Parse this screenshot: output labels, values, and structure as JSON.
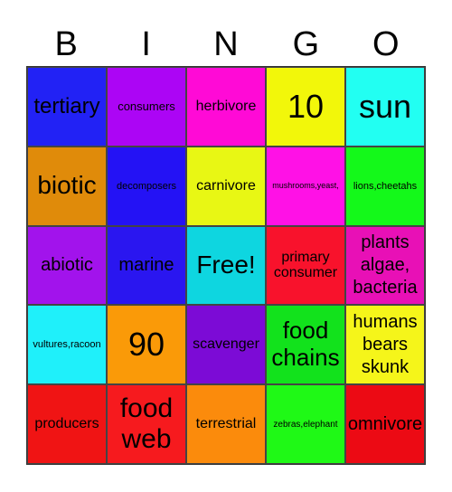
{
  "header": {
    "letters": [
      "B",
      "I",
      "N",
      "G",
      "O"
    ]
  },
  "cells": [
    {
      "text": "tertiary",
      "color": "#2222f5"
    },
    {
      "text": "consumers",
      "color": "#ac05f5"
    },
    {
      "text": "herbivore",
      "color": "#ff0ad6"
    },
    {
      "text": "10",
      "color": "#f2f70a"
    },
    {
      "text": "sun",
      "color": "#22fff2"
    },
    {
      "text": "biotic",
      "color": "#e08b0a"
    },
    {
      "text": "decomposers",
      "color": "#2412f5"
    },
    {
      "text": "carnivore",
      "color": "#e8f714"
    },
    {
      "text": "mushrooms,yeast,",
      "color": "#ff11e6"
    },
    {
      "text": "lions,cheetahs",
      "color": "#14f91a"
    },
    {
      "text": "abiotic",
      "color": "#a213ec"
    },
    {
      "text": "marine",
      "color": "#2a16f0"
    },
    {
      "text": "Free!",
      "color": "#0ed6e0"
    },
    {
      "text": "primary consumer",
      "color": "#f8122c"
    },
    {
      "text": "plants algae, bacteria",
      "color": "#e810b6"
    },
    {
      "text": "vultures,racoon",
      "color": "#1ff0fa"
    },
    {
      "text": "90",
      "color": "#fa9a08"
    },
    {
      "text": "scavenger",
      "color": "#7c0bd6"
    },
    {
      "text": "food chains",
      "color": "#12e21c"
    },
    {
      "text": "humans bears skunk",
      "color": "#f5f51a"
    },
    {
      "text": "producers",
      "color": "#f01414"
    },
    {
      "text": "food web",
      "color": "#f61a1e"
    },
    {
      "text": "terrestrial",
      "color": "#fb8b0c"
    },
    {
      "text": "zebras,elephant",
      "color": "#1ff916"
    },
    {
      "text": "omnivore",
      "color": "#ec0a14"
    }
  ]
}
